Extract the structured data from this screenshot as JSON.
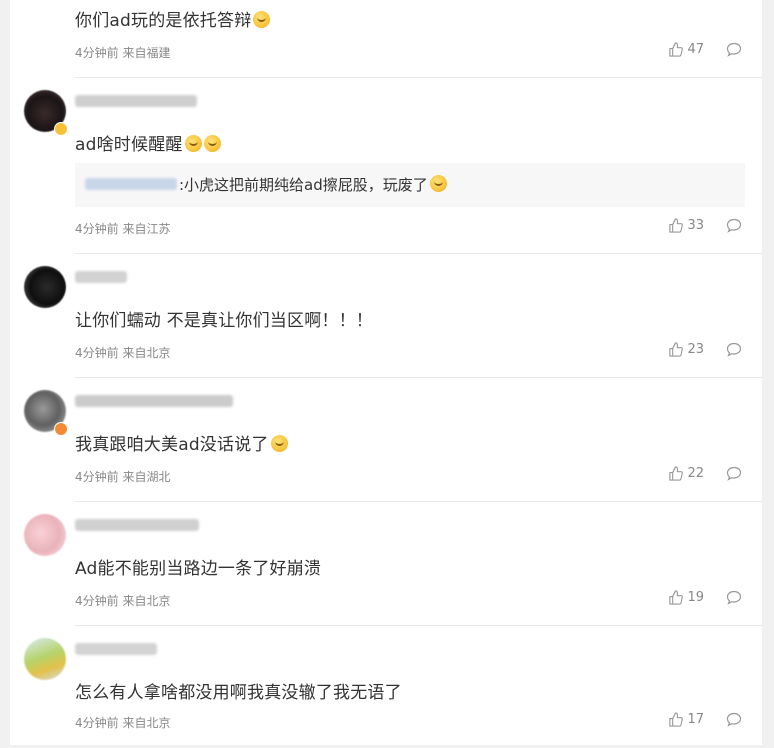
{
  "comments": [
    {
      "text": "你们ad玩的是依托答辩",
      "emojis": 1,
      "time": "4分钟前",
      "location": "来自福建",
      "likes": "47"
    },
    {
      "text": "ad啥时候醒醒",
      "emojis": 2,
      "reply": ":小虎这把前期纯给ad擦屁股，玩废了",
      "time": "4分钟前",
      "location": "来自江苏",
      "likes": "33"
    },
    {
      "text": "让你们蠕动 不是真让你们当区啊！！！",
      "emojis": 0,
      "time": "4分钟前",
      "location": "来自北京",
      "likes": "23"
    },
    {
      "text": "我真跟咱大美ad没话说了",
      "emojis": 1,
      "time": "4分钟前",
      "location": "来自湖北",
      "likes": "22"
    },
    {
      "text": "Ad能不能别当路边一条了好崩溃",
      "emojis": 0,
      "time": "4分钟前",
      "location": "来自北京",
      "likes": "19"
    },
    {
      "text": "怎么有人拿啥都没用啊我真没辙了我无语了",
      "emojis": 0,
      "time": "4分钟前",
      "location": "来自北京",
      "likes": "17"
    }
  ],
  "icons": {
    "like": "thumbs-up-icon",
    "reply": "comment-bubble-icon",
    "emoji": "laughing-face-emoji"
  },
  "colors": {
    "text": "#333333",
    "meta": "#888888",
    "divider": "#e8e8e8",
    "reply_bg": "#f7f7f7"
  }
}
